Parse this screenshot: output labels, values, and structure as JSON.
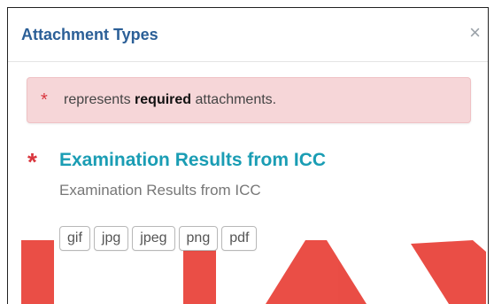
{
  "modal": {
    "title": "Attachment Types",
    "close_glyph": "×"
  },
  "alert": {
    "star": "*",
    "text_before": "represents",
    "text_bold": "required",
    "text_after": "attachments."
  },
  "attachment": {
    "required_star": "*",
    "title": "Examination Results from ICC",
    "description": "Examination Results from ICC",
    "file_types": [
      "gif",
      "jpg",
      "jpeg",
      "png",
      "pdf"
    ]
  },
  "colors": {
    "title": "#2b5f97",
    "link": "#1a9db4",
    "required": "#d9363e",
    "alert_bg": "#f6d6d8",
    "watermark": "#e7352c"
  }
}
